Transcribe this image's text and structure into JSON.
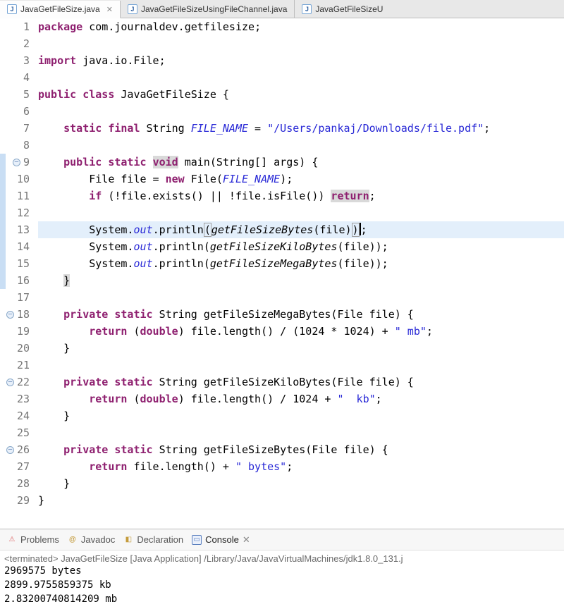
{
  "tabs": [
    {
      "label": "JavaGetFileSize.java",
      "active": true,
      "closable": true
    },
    {
      "label": "JavaGetFileSizeUsingFileChannel.java",
      "active": false,
      "closable": false
    },
    {
      "label": "JavaGetFileSizeU",
      "active": false,
      "closable": false
    }
  ],
  "gutter": {
    "lines": [
      "1",
      "2",
      "3",
      "4",
      "5",
      "6",
      "7",
      "8",
      "9",
      "10",
      "11",
      "12",
      "13",
      "14",
      "15",
      "16",
      "17",
      "18",
      "19",
      "20",
      "21",
      "22",
      "23",
      "24",
      "25",
      "26",
      "27",
      "28",
      "29"
    ],
    "fold_lines": [
      9,
      18,
      22,
      26
    ],
    "marker_lines": [
      9,
      10,
      11,
      12,
      13,
      14,
      15,
      16
    ],
    "highlight_line": 13
  },
  "code": {
    "pkg_kw": "package",
    "pkg_name": "com.journaldev.getfilesize",
    "imp_kw": "import",
    "imp_name": "java.io.File",
    "public_kw": "public",
    "class_kw": "class",
    "class_name": "JavaGetFileSize",
    "static_kw": "static",
    "final_kw": "final",
    "string_t": "String",
    "file_name_id": "FILE_NAME",
    "eq": " = ",
    "file_name_str": "\"/Users/pankaj/Downloads/file.pdf\"",
    "void_kw": "void",
    "main_id": "main",
    "args_sig": "(String[] args)",
    "File_t": "File",
    "file_id": "file",
    "new_kw": "new",
    "if_kw": "if",
    "cond_l": " (!file.exists() || !file.isFile()) ",
    "return_kw": "return",
    "sys": "System.",
    "out": "out",
    "println": ".println",
    "call_b": "getFileSizeBytes",
    "call_k": "getFileSizeKiloBytes",
    "call_m": "getFileSizeMegaBytes",
    "arg_file": "(file)",
    "private_kw": "private",
    "double_kw": "double",
    "m_body": " file.length() / (1024 * 1024) + ",
    "m_suf": "\" mb\"",
    "k_body": " file.length() / 1024 + ",
    "k_suf": "\"  kb\"",
    "b_body": " file.length() + ",
    "b_suf": "\" bytes\"",
    "sig_file": "(File file)"
  },
  "views": {
    "problems": "Problems",
    "javadoc": "Javadoc",
    "declaration": "Declaration",
    "console": "Console"
  },
  "console": {
    "header": "<terminated> JavaGetFileSize [Java Application] /Library/Java/JavaVirtualMachines/jdk1.8.0_131.j",
    "lines": [
      "2969575 bytes",
      "2899.9755859375  kb",
      "2.83200740814209 mb"
    ]
  }
}
